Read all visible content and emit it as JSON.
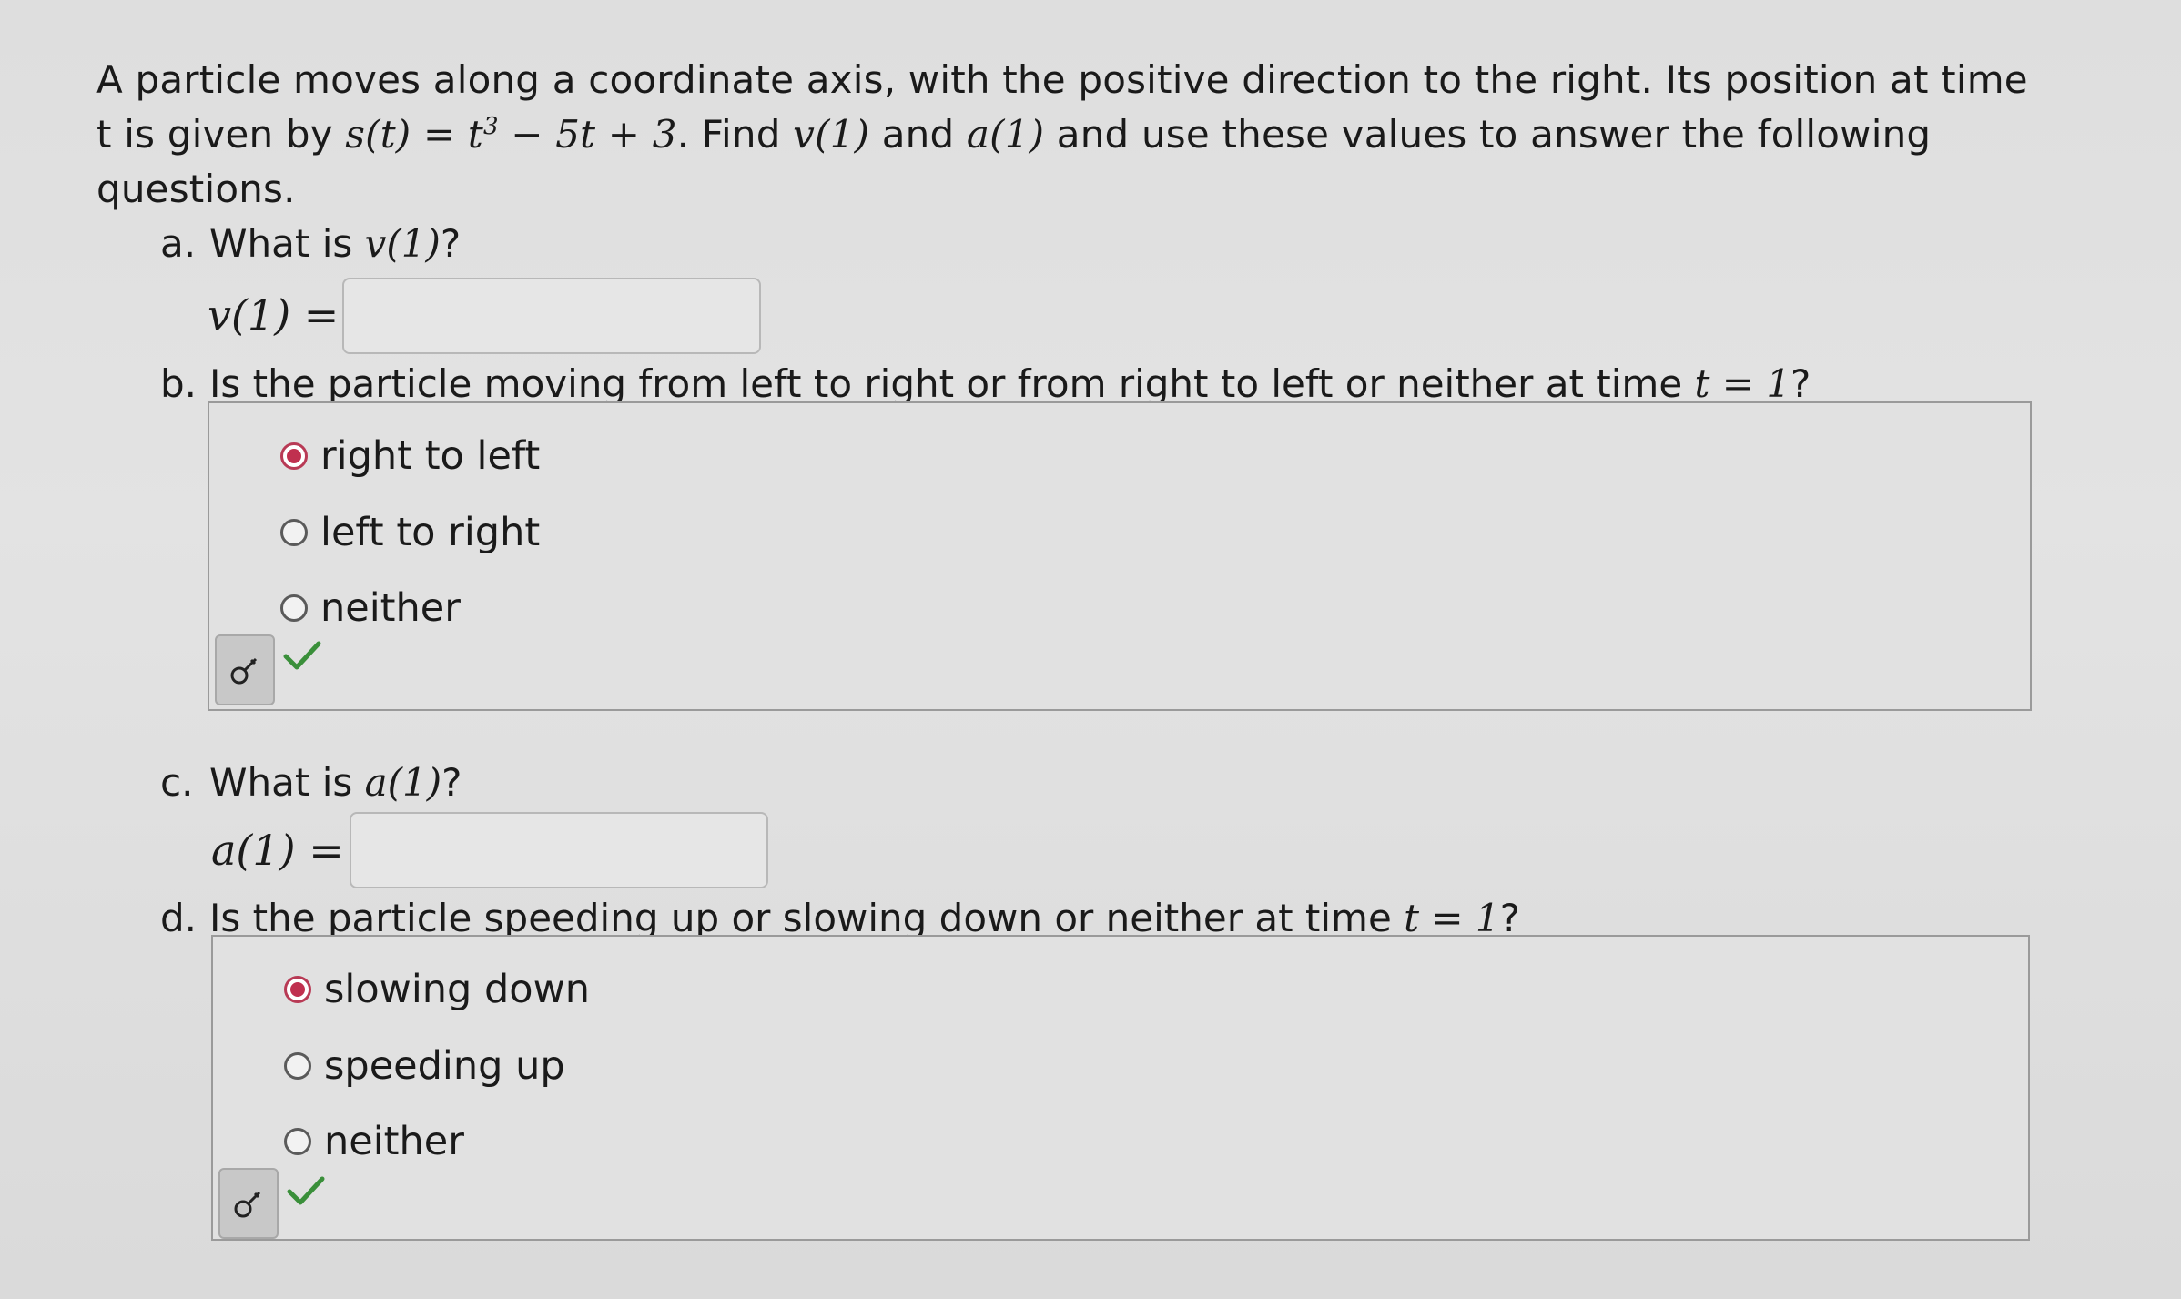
{
  "intro": {
    "text1": "A particle moves along a coordinate axis, with the positive direction to the right. Its position at time t is given by ",
    "position_fn_lhs": "s(t) = t",
    "position_fn_exp": "3",
    "position_fn_rhs": " − 5t + 3",
    "text2": ". Find ",
    "v1": "v(1)",
    "text3": " and ",
    "a1": "a(1)",
    "text4": " and use these values to answer the following questions."
  },
  "part_a": {
    "label": "a.",
    "question_prefix": "What is ",
    "question_math": "v(1)",
    "question_suffix": "?",
    "eq_lhs": "v(1) =",
    "input_value": ""
  },
  "part_b": {
    "label": "b.",
    "question_prefix": "Is the particle moving from left to right or from right to left or neither at time ",
    "question_math": "t = 1",
    "question_suffix": "?",
    "options": [
      "right to left",
      "left to right",
      "neither"
    ],
    "selected_index": 0,
    "status_icon": "check-icon"
  },
  "part_c": {
    "label": "c.",
    "question_prefix": "What is ",
    "question_math": "a(1)",
    "question_suffix": "?",
    "eq_lhs": "a(1) =",
    "input_value": ""
  },
  "part_d": {
    "label": "d.",
    "question_prefix": "Is the particle speeding up or slowing down or neither at time ",
    "question_math": "t = 1",
    "question_suffix": "?",
    "options": [
      "slowing down",
      "speeding up",
      "neither"
    ],
    "selected_index": 0,
    "status_icon": "check-icon"
  },
  "colors": {
    "selected_radio": "#c0304f",
    "check": "#3a8f3a",
    "background": "#dcdcdc"
  }
}
